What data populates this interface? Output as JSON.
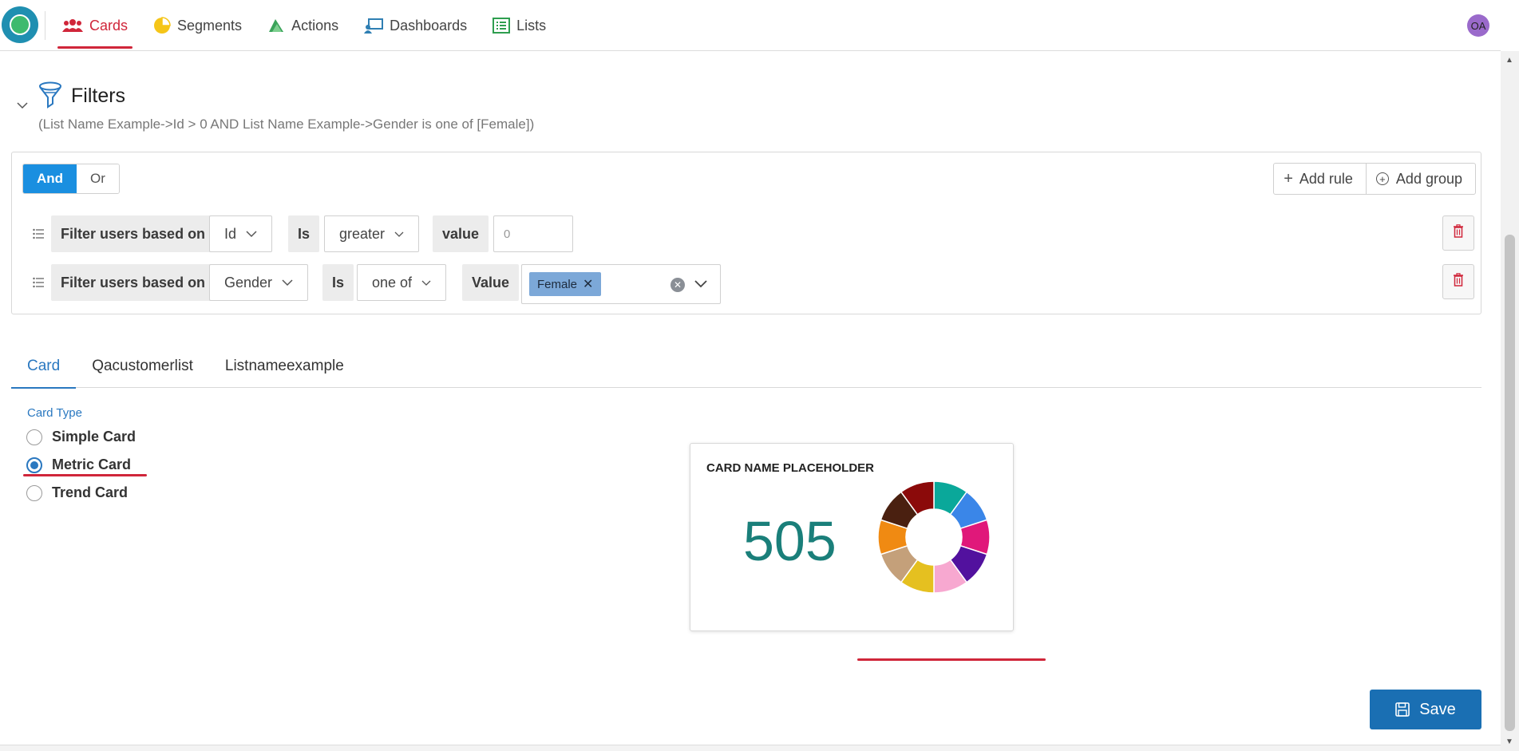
{
  "nav": {
    "items": [
      {
        "label": "Cards",
        "icon": "users-icon"
      },
      {
        "label": "Segments",
        "icon": "pie-chart-icon"
      },
      {
        "label": "Actions",
        "icon": "actions-icon"
      },
      {
        "label": "Dashboards",
        "icon": "dashboard-icon"
      },
      {
        "label": "Lists",
        "icon": "list-icon"
      }
    ],
    "active": "Cards",
    "avatar_initials": "OA"
  },
  "filters": {
    "title": "Filters",
    "summary": "(List Name Example->Id > 0 AND List Name Example->Gender is one of [Female])",
    "combinator": {
      "and_label": "And",
      "or_label": "Or",
      "selected": "And"
    },
    "add_rule_label": "Add rule",
    "add_group_label": "Add group",
    "rules": [
      {
        "prefix": "Filter users based on",
        "field": "Id",
        "is_label": "Is",
        "operator": "greater",
        "value_label": "value",
        "value_placeholder": "0"
      },
      {
        "prefix": "Filter users based on",
        "field": "Gender",
        "is_label": "Is",
        "operator": "one of",
        "value_label": "Value",
        "selected_values": [
          "Female"
        ]
      }
    ]
  },
  "tabs": [
    "Card",
    "Qacustomerlist",
    "Listnameexample"
  ],
  "active_tab": "Card",
  "card_type": {
    "label": "Card Type",
    "options": [
      "Simple Card",
      "Metric Card",
      "Trend Card"
    ],
    "selected": "Metric Card"
  },
  "preview": {
    "title": "CARD NAME PLACEHOLDER",
    "metric_value": "505",
    "donut_colors": [
      "#0aa89a",
      "#3a86e8",
      "#e0187a",
      "#52119e",
      "#f7a8d0",
      "#e5c020",
      "#c4a07a",
      "#f08a12",
      "#4a2010",
      "#8b0a0a"
    ]
  },
  "save_label": "Save",
  "colors": {
    "accent_blue": "#1a8fe0",
    "active_nav_red": "#d0263a",
    "save_blue": "#1a6fb3",
    "metric_teal": "#1a7f7a"
  }
}
